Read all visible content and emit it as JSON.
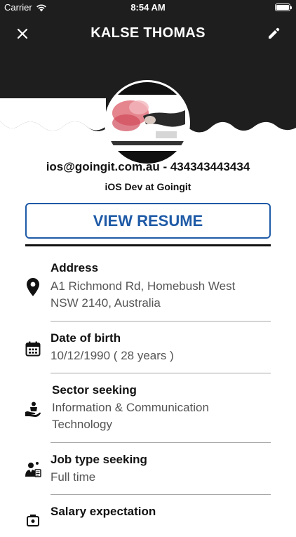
{
  "status_bar": {
    "carrier": "Carrier",
    "time": "8:54 AM"
  },
  "header": {
    "name": "KALSE THOMAS",
    "close_icon": "close-icon",
    "edit_icon": "pencil-icon",
    "background": "#1e1e1e"
  },
  "profile": {
    "contact": "ios@goingit.com.au - 434343443434",
    "role": "iOS Dev at Goingit",
    "resume_button": "VIEW RESUME",
    "accent": "#1e5aa6"
  },
  "details": [
    {
      "label": "Address",
      "value": "A1 Richmond Rd, Homebush West\nNSW 2140, Australia",
      "icon": "map-pin-icon"
    },
    {
      "label": "Date of birth",
      "value": "10/12/1990 ( 28 years )",
      "icon": "calendar-icon"
    },
    {
      "label": "Sector seeking",
      "value": "Information & Communication\nTechnology",
      "icon": "sector-icon"
    },
    {
      "label": "Job type seeking",
      "value": "Full time",
      "icon": "job-type-icon"
    },
    {
      "label": "Salary expectation",
      "value": "",
      "icon": "salary-icon"
    }
  ]
}
